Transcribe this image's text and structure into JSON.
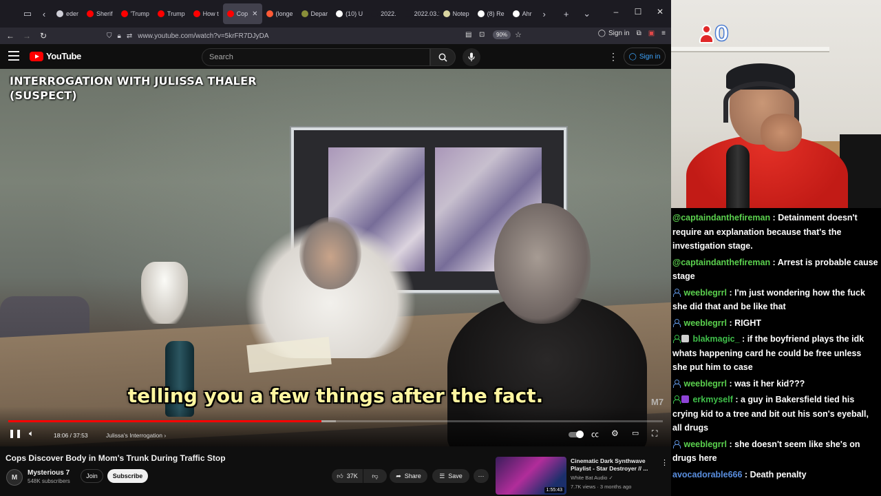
{
  "browser": {
    "tabs": [
      {
        "label": "eder",
        "fav": "#cfcfd8"
      },
      {
        "label": "Sherif",
        "fav": "#ff0000"
      },
      {
        "label": "'Trump",
        "fav": "#ff0000"
      },
      {
        "label": "Trump",
        "fav": "#ff0000"
      },
      {
        "label": "How t",
        "fav": "#ff0000"
      },
      {
        "label": "Cop",
        "fav": "#ff0000",
        "active": true
      },
      {
        "label": "(longe",
        "fav": "#ff5a36"
      },
      {
        "label": "Depar",
        "fav": "#8a8f3a"
      },
      {
        "label": "(10) U",
        "fav": "#ffffff"
      },
      {
        "label": "2022.",
        "fav": "#1c1b22"
      },
      {
        "label": "2022.03.1",
        "fav": "#1c1b22"
      },
      {
        "label": "Notep",
        "fav": "#d9d4a0"
      },
      {
        "label": "(8) Re",
        "fav": "#ffffff"
      },
      {
        "label": "Ahr",
        "fav": "#ffffff"
      }
    ],
    "url": "www.youtube.com/watch?v=5krFR7DJyDA",
    "zoom": "90%",
    "signin_label": "Sign in"
  },
  "youtube": {
    "logo_text": "YouTube",
    "search_placeholder": "Search",
    "signin_label": "Sign in"
  },
  "video": {
    "overlay_title_line1": "INTERROGATION WITH JULISSA THALER",
    "overlay_title_line2": "(SUSPECT)",
    "subtitle": "telling you a few things after the fact.",
    "watermark": "M7",
    "time": "18:06 / 37:53",
    "chapter": "Julissa's Interrogation",
    "progress_fraction": 0.478,
    "loaded_fraction": 0.5
  },
  "below": {
    "title": "Cops Discover Body in Mom's Trunk During Traffic Stop",
    "channel_name": "Mysterious 7",
    "channel_initial": "M",
    "subscribers": "548K subscribers",
    "join_label": "Join",
    "subscribe_label": "Subscribe",
    "like_count": "37K",
    "share_label": "Share",
    "save_label": "Save",
    "rec": {
      "title": "Cinematic Dark Synthwave Playlist - Star Destroyer // ...",
      "channel": "White Bat Audio",
      "meta": "7.7K views · 3 months ago",
      "duration": "1:55:43"
    }
  },
  "stream": {
    "viewer_count": "0"
  },
  "chat": [
    {
      "user": "@captaindanthefireman",
      "color": "#5bd14e",
      "badge": "",
      "text": "Detainment doesn't require an explanation because that's the investigation stage."
    },
    {
      "user": "@captaindanthefireman",
      "color": "#5bd14e",
      "badge": "",
      "text": "Arrest is probable cause stage"
    },
    {
      "user": "weeblegrrl",
      "color": "#5bd14e",
      "badge": "person",
      "text": "I'm just wondering how the fuck she did that and be like that"
    },
    {
      "user": "weeblegrrl",
      "color": "#5bd14e",
      "badge": "person",
      "text": "RIGHT"
    },
    {
      "user": "blakmagic_",
      "color": "#3fbf4a",
      "badge": "green-sub",
      "text": "if the boyfriend plays the idk whats happening card he could be free unless she put him to case"
    },
    {
      "user": "weeblegrrl",
      "color": "#5bd14e",
      "badge": "person",
      "text": "was it her kid???"
    },
    {
      "user": "erkmyself",
      "color": "#3fbf4a",
      "badge": "green-purple",
      "text": "a guy in Bakersfield tied his crying kid to a tree and bit out his son's eyeball, all drugs"
    },
    {
      "user": "weeblegrrl",
      "color": "#5bd14e",
      "badge": "person",
      "text": "she doesn't seem like she's on drugs here"
    },
    {
      "user": "avocadorable666",
      "color": "#5a8fe0",
      "badge": "",
      "text": "Death penalty"
    }
  ]
}
